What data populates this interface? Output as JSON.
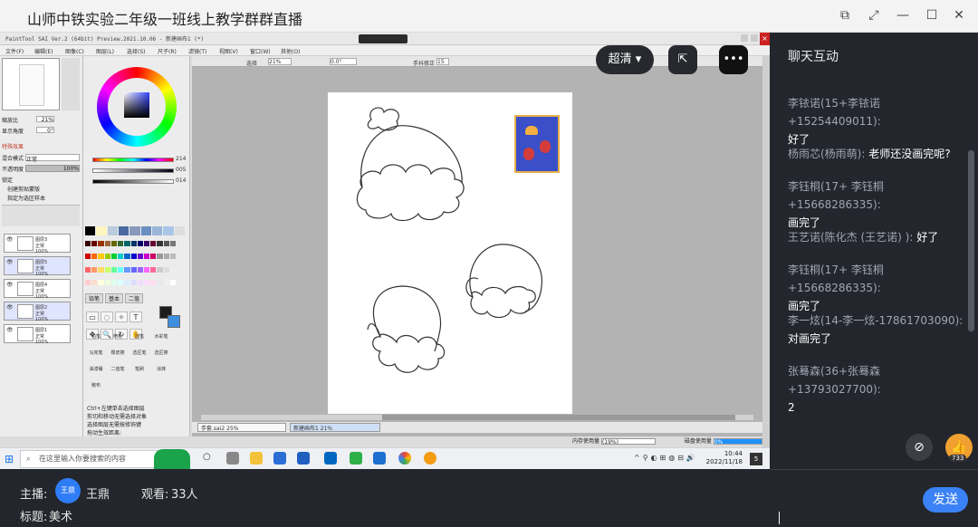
{
  "window": {
    "title": "山师中铁实验二年级一班线上教学群群直播"
  },
  "sai": {
    "titlebar": "PaintTool SAI Ver.2 (64bit) Preview.2021.10.06 - 新建画布1 (*)",
    "menu": [
      "文件(F)",
      "编辑(E)",
      "图像(C)",
      "图层(L)",
      "选择(S)",
      "尺子(R)",
      "滤镜(T)",
      "视图(V)",
      "窗口(W)",
      "其他(O)"
    ],
    "props": {
      "zoom_label": "缩放比",
      "zoom_value": "21%",
      "angle_label": "显示角度",
      "angle_value": "0°",
      "effects_label": "特殊效果",
      "blend_label": "混合模式",
      "blend_value": "正常",
      "opacity_label": "不透明度",
      "opacity_value": "100%",
      "lock_label": "锁定",
      "clip_label": "创建剪贴蒙版",
      "ref_label": "指定为选区样本"
    },
    "layers": [
      {
        "name": "图层3",
        "mode": "正常",
        "opacity": "100%"
      },
      {
        "name": "图层5",
        "mode": "正常",
        "opacity": "100%"
      },
      {
        "name": "图层4",
        "mode": "正常",
        "opacity": "100%"
      },
      {
        "name": "图层2",
        "mode": "正常",
        "opacity": "100%"
      },
      {
        "name": "图层1",
        "mode": "正常",
        "opacity": "100%"
      }
    ],
    "hsv": {
      "h": "214",
      "s": "005",
      "v": "014"
    },
    "tool_tabs": [
      "铅笔",
      "基本",
      "二值"
    ],
    "brushes": [
      "铅笔",
      "喷枪",
      "圆笔",
      "水彩笔",
      "马克笔",
      "橡皮擦",
      "选区笔",
      "选区擦",
      "油漆桶",
      "二值笔",
      "笔刷",
      "涂抹",
      "散布"
    ],
    "checks": [
      "Ctrl+左键单击选择图层",
      "剪切和移动无需选择对象",
      "选择图层无需按修饰键"
    ],
    "move_label": "拖动生效距离:",
    "move1_label": "移动",
    "move1_value": "±8 px",
    "move2_label": "选择&移动",
    "move2_value": "±8 px",
    "canvas_toolbar": {
      "select_label": "选择",
      "zoom": "21%",
      "angle": "0.0°",
      "stabilizer_label": "手抖修正",
      "stabilizer_value": "15"
    },
    "file_tabs": [
      {
        "name": "手套.sai2",
        "zoom": "25%"
      },
      {
        "name": "新建画布1",
        "zoom": "21%"
      }
    ],
    "memory_label": "内存使用量",
    "memory_value": "(19%)",
    "disk_label": "磁盘使用量",
    "disk_value": "0%"
  },
  "overlay": {
    "quality_label": "超清",
    "more_label": "•••"
  },
  "taskbar": {
    "search_placeholder": "在这里输入你要搜索的内容",
    "time": "10:44",
    "date": "2022/11/18",
    "notif": "5"
  },
  "bottom": {
    "host_label": "主播:",
    "host_avatar": "王鼎",
    "host_name": "王鼎",
    "viewers_label": "观看:",
    "viewers_value": "33人",
    "topic_label": "标题:",
    "topic_value": "美术"
  },
  "chat": {
    "title": "聊天互动",
    "messages": [
      {
        "name": "李铱诺(15+李铱诺+15254409011):",
        "text": "好了"
      },
      {
        "name": "杨雨芯(杨雨萌):",
        "text": "老师还没画完呢?"
      },
      {
        "name": "李钰桐(17+ 李钰桐+15668286335):",
        "text": "画完了"
      },
      {
        "name": "王艺诺(陈化杰 (王艺诺) ):",
        "text": "好了"
      },
      {
        "name": "李钰桐(17+ 李钰桐+15668286335):",
        "text": "画完了"
      },
      {
        "name": "李一炫(14-李一炫-17861703090):",
        "text": "对画完了"
      },
      {
        "name": "张蓦森(36+张蓦森+13793027700):",
        "text": "2"
      }
    ],
    "like_count": "733",
    "send_label": "发送"
  },
  "colors": {
    "accent": "#3b82f6",
    "panel": "#23262d"
  }
}
